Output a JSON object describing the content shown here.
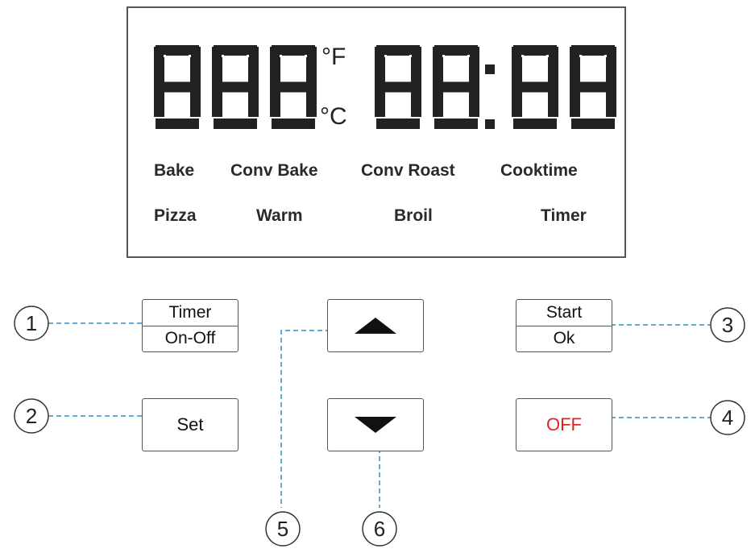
{
  "display": {
    "temperature_digits": "888",
    "unit_f": "°F",
    "unit_c": "°C",
    "clock_digits": "88:88",
    "modes_row1": [
      "Bake",
      "Conv Bake",
      "Conv Roast",
      "Cooktime"
    ],
    "modes_row2": [
      "Pizza",
      "Warm",
      "Broil",
      "Timer"
    ]
  },
  "buttons": {
    "timer_top": "Timer",
    "timer_bottom": "On-Off",
    "set": "Set",
    "up": "up-arrow-icon",
    "down": "down-arrow-icon",
    "start_top": "Start",
    "start_bottom": "Ok",
    "off": "OFF"
  },
  "callouts": [
    "1",
    "2",
    "3",
    "4",
    "5",
    "6"
  ],
  "colors": {
    "off_text": "#e32222",
    "callout_line": "#2f8fc7",
    "segment": "#222222"
  }
}
